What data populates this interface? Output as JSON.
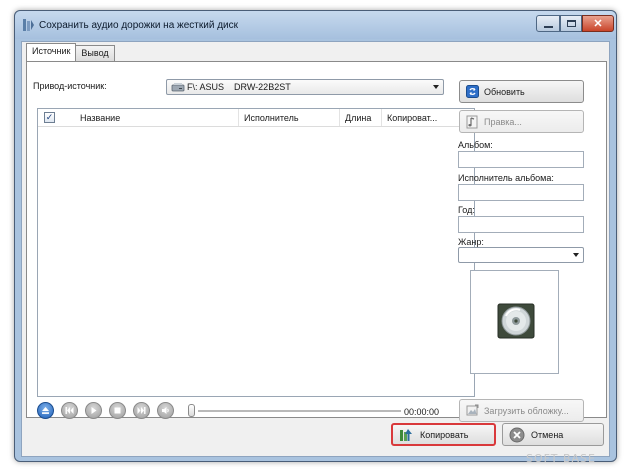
{
  "window": {
    "title": "Сохранить аудио дорожки на жесткий диск"
  },
  "tabs": [
    {
      "label": "Источник",
      "active": true
    },
    {
      "label": "Вывод",
      "active": false
    }
  ],
  "source": {
    "drive_label": "Привод-источник:",
    "drive_value": "F\\: ASUS    DRW-22B2ST",
    "refresh_label": "Обновить",
    "edit_label": "Правка..."
  },
  "tracks": {
    "columns": [
      "Название",
      "Исполнитель",
      "Длина",
      "Копироват..."
    ],
    "all_checked": true,
    "rows": []
  },
  "metadata": {
    "album_label": "Альбом:",
    "album_value": "",
    "album_artist_label": "Исполнитель альбома:",
    "album_artist_value": "",
    "year_label": "Год:",
    "year_value": "",
    "genre_label": "Жанр:",
    "genre_value": "",
    "load_cover_label": "Загрузить обложку..."
  },
  "player": {
    "time": "00:00:00",
    "position": 0
  },
  "actions": {
    "copy_label": "Копировать",
    "cancel_label": "Отмена"
  },
  "watermark": "SOFT BASE",
  "colors": {
    "highlight": "#d9393b",
    "accent": "#1d5fb8"
  }
}
